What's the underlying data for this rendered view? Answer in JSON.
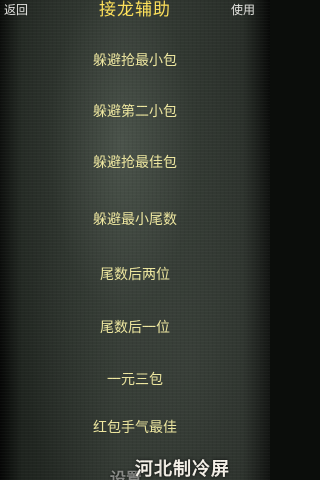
{
  "header": {
    "back_label": "返回",
    "title": "接龙辅助",
    "use_label": "使用"
  },
  "menu": {
    "items": [
      "躲避抢最小包",
      "躲避第二小包",
      "躲避抢最佳包",
      "躲避最小尾数",
      "尾数后两位",
      "尾数后一位",
      "一元三包",
      "红包手气最佳"
    ]
  },
  "watermark": {
    "text": "河北制冷屏",
    "partial_text": "设置"
  },
  "colors": {
    "title": "#ffe25a",
    "menu_text": "#efe8a0",
    "header_text": "#e6e6e2"
  }
}
